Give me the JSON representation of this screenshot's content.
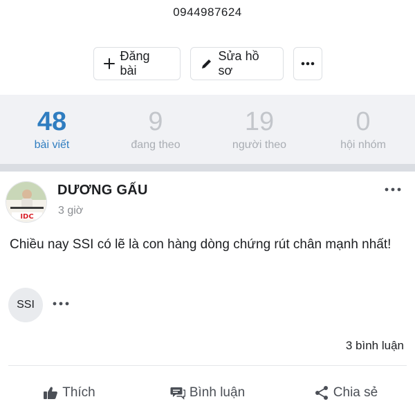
{
  "profile": {
    "phone": "0944987624"
  },
  "actions": {
    "post_label": "Đăng bài",
    "edit_label": "Sửa hồ sơ"
  },
  "stats": [
    {
      "value": "48",
      "label": "bài viết"
    },
    {
      "value": "9",
      "label": "đang theo"
    },
    {
      "value": "19",
      "label": "người theo"
    },
    {
      "value": "0",
      "label": "hội nhóm"
    }
  ],
  "post": {
    "author": "DƯƠNG GẤU",
    "time": "3 giờ",
    "content": "Chiều nay SSI có lẽ là con hàng dòng chứng rút chân mạnh nhất!",
    "tag": "SSI",
    "comments": "3 bình luận",
    "avatar_text": "IDC"
  },
  "bottom_bar": {
    "like_label": "Thích",
    "comment_label": "Bình luận",
    "share_label": "Chia sẻ"
  },
  "colors": {
    "accent": "#2f7dc0",
    "stats_bg": "#f1f2f5",
    "muted": "#c3c6cb"
  },
  "icons": [
    "plus-icon",
    "pencil-icon",
    "more-icon",
    "like-icon",
    "comment-icon",
    "share-icon"
  ]
}
